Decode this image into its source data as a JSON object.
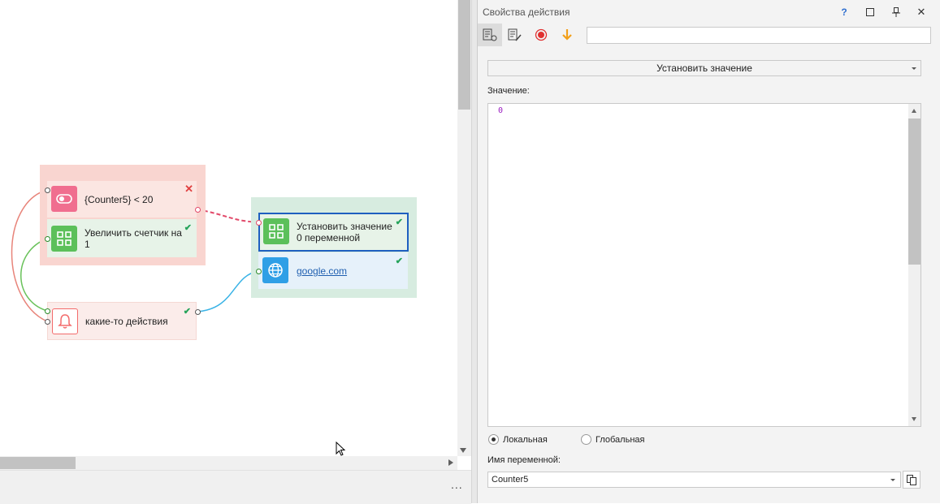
{
  "canvas": {
    "nodes": {
      "condition": {
        "text": "{Counter5} < 20"
      },
      "increment": {
        "line1": "Увеличить счетчик на",
        "line2": "1"
      },
      "set_value": {
        "line1": "Установить значение",
        "line2": "0 переменной"
      },
      "google": {
        "text": "google.com"
      },
      "actions": {
        "text": "какие-то действия"
      }
    },
    "more": "..."
  },
  "panel": {
    "title": "Свойства действия",
    "title_buttons": {
      "help": "?",
      "maximize": "□",
      "pin": "⊥",
      "close": "✕"
    },
    "toolbar": {
      "search_value": ""
    },
    "action": {
      "selected": "Установить значение"
    },
    "value": {
      "label": "Значение:",
      "text": "0"
    },
    "scope": {
      "local": "Локальная",
      "global": "Глобальная",
      "selected": "local"
    },
    "variable": {
      "label": "Имя переменной:",
      "value": "Counter5"
    }
  },
  "colors": {
    "red_group": "#f9d5d0",
    "green_group": "#d7ece0",
    "pink_icon": "#f06e8f",
    "green_icon": "#5cc05a",
    "blue_icon": "#2f9fe6",
    "bell_icon": "#f36b6b",
    "selected_border": "#1e5fc0"
  }
}
